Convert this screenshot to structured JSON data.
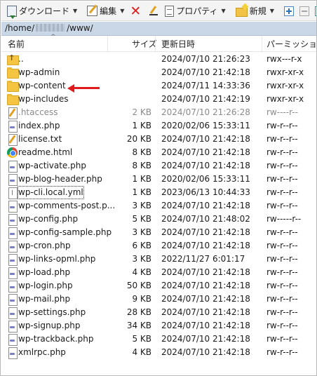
{
  "colors": {
    "path_bar": "#cad7e7",
    "highlight_arrow": "#e01b1b",
    "dim_text": "#8a8a8a"
  },
  "toolbar": {
    "download_label": "ダウンロード",
    "edit_label": "編集",
    "properties_label": "プロパティ",
    "new_label": "新規",
    "icons": [
      "download-icon",
      "edit-icon",
      "delete-icon",
      "rename-icon",
      "properties-icon",
      "new-folder-icon",
      "expand-icon",
      "collapse-icon",
      "filter-icon"
    ]
  },
  "path": {
    "prefix": "/home/",
    "suffix": "/www/"
  },
  "columns": {
    "name": "名前",
    "size": "サイズ",
    "modified": "更新日時",
    "permissions": "パーミッション"
  },
  "files": [
    {
      "name": "..",
      "size": "",
      "modified": "2024/07/10 21:26:23",
      "permissions": "rwx---r-x",
      "type": "parent"
    },
    {
      "name": "wp-admin",
      "size": "",
      "modified": "2024/07/10 21:42:18",
      "permissions": "rwxr-xr-x",
      "type": "folder"
    },
    {
      "name": "wp-content",
      "size": "",
      "modified": "2024/07/11 14:33:36",
      "permissions": "rwxr-xr-x",
      "type": "folder"
    },
    {
      "name": "wp-includes",
      "size": "",
      "modified": "2024/07/10 21:42:19",
      "permissions": "rwxr-xr-x",
      "type": "folder"
    },
    {
      "name": ".htaccess",
      "size": "2 KB",
      "modified": "2024/07/10 21:26:28",
      "permissions": "rw----r--",
      "type": "text"
    },
    {
      "name": "index.php",
      "size": "1 KB",
      "modified": "2020/02/06 15:33:11",
      "permissions": "rw-r--r--",
      "type": "php"
    },
    {
      "name": "license.txt",
      "size": "20 KB",
      "modified": "2024/07/10 21:42:18",
      "permissions": "rw-r--r--",
      "type": "text"
    },
    {
      "name": "readme.html",
      "size": "8 KB",
      "modified": "2024/07/10 21:42:18",
      "permissions": "rw-r--r--",
      "type": "html"
    },
    {
      "name": "wp-activate.php",
      "size": "8 KB",
      "modified": "2024/07/10 21:42:18",
      "permissions": "rw-r--r--",
      "type": "php"
    },
    {
      "name": "wp-blog-header.php",
      "size": "1 KB",
      "modified": "2020/02/06 15:33:11",
      "permissions": "rw-r--r--",
      "type": "php"
    },
    {
      "name": "wp-cli.local.yml",
      "size": "1 KB",
      "modified": "2023/06/13 10:44:33",
      "permissions": "rw-r--r--",
      "type": "yml"
    },
    {
      "name": "wp-comments-post.p...",
      "size": "3 KB",
      "modified": "2024/07/10 21:42:18",
      "permissions": "rw-r--r--",
      "type": "php"
    },
    {
      "name": "wp-config.php",
      "size": "5 KB",
      "modified": "2024/07/10 21:48:02",
      "permissions": "rw-----r--",
      "type": "php"
    },
    {
      "name": "wp-config-sample.php",
      "size": "3 KB",
      "modified": "2024/07/10 21:42:18",
      "permissions": "rw-r--r--",
      "type": "php"
    },
    {
      "name": "wp-cron.php",
      "size": "6 KB",
      "modified": "2024/07/10 21:42:18",
      "permissions": "rw-r--r--",
      "type": "php"
    },
    {
      "name": "wp-links-opml.php",
      "size": "3 KB",
      "modified": "2022/11/27 6:01:17",
      "permissions": "rw-r--r--",
      "type": "php"
    },
    {
      "name": "wp-load.php",
      "size": "4 KB",
      "modified": "2024/07/10 21:42:18",
      "permissions": "rw-r--r--",
      "type": "php"
    },
    {
      "name": "wp-login.php",
      "size": "50 KB",
      "modified": "2024/07/10 21:42:18",
      "permissions": "rw-r--r--",
      "type": "php"
    },
    {
      "name": "wp-mail.php",
      "size": "9 KB",
      "modified": "2024/07/10 21:42:18",
      "permissions": "rw-r--r--",
      "type": "php"
    },
    {
      "name": "wp-settings.php",
      "size": "28 KB",
      "modified": "2024/07/10 21:42:18",
      "permissions": "rw-r--r--",
      "type": "php"
    },
    {
      "name": "wp-signup.php",
      "size": "34 KB",
      "modified": "2024/07/10 21:42:18",
      "permissions": "rw-r--r--",
      "type": "php"
    },
    {
      "name": "wp-trackback.php",
      "size": "5 KB",
      "modified": "2024/07/10 21:42:18",
      "permissions": "rw-r--r--",
      "type": "php"
    },
    {
      "name": "xmlrpc.php",
      "size": "4 KB",
      "modified": "2024/07/10 21:42:18",
      "permissions": "rw-r--r--",
      "type": "php"
    }
  ]
}
